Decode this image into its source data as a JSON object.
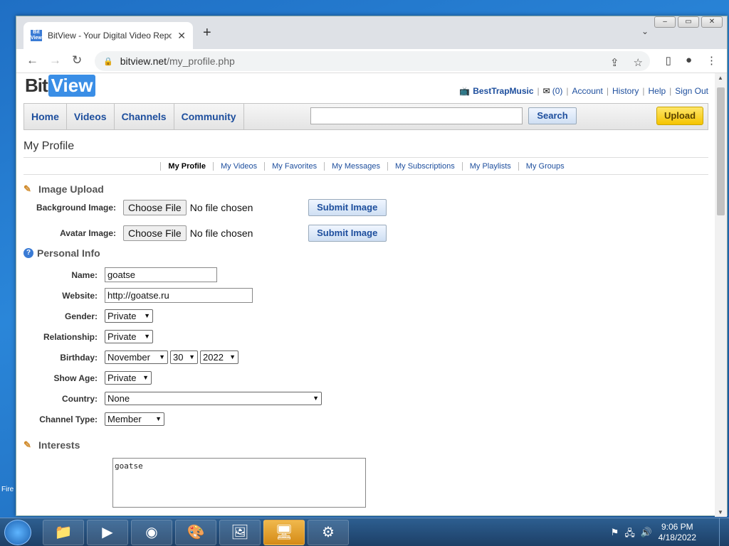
{
  "desktop": {
    "edge_label": "Fire"
  },
  "browser": {
    "tab_title": "BitView - Your Digital Video Repository",
    "favicon_text": "Bit View",
    "url_host": "bitview.net",
    "url_path": "/my_profile.php"
  },
  "site": {
    "logo_bit": "Bit",
    "logo_view": "View",
    "userbar": {
      "username": "BestTrapMusic",
      "messages": "(0)",
      "links": [
        "Account",
        "History",
        "Help",
        "Sign Out"
      ]
    },
    "nav": [
      "Home",
      "Videos",
      "Channels",
      "Community"
    ],
    "search_button": "Search",
    "upload_button": "Upload"
  },
  "page": {
    "title": "My Profile",
    "subnav": [
      "My Profile",
      "My Videos",
      "My Favorites",
      "My Messages",
      "My Subscriptions",
      "My Playlists",
      "My Groups"
    ],
    "image_upload": {
      "heading": "Image Upload",
      "background_label": "Background Image:",
      "avatar_label": "Avatar Image:",
      "choose_file": "Choose File",
      "no_file": "No file chosen",
      "submit": "Submit Image"
    },
    "personal_info": {
      "heading": "Personal Info",
      "name_label": "Name:",
      "name_value": "goatse",
      "website_label": "Website:",
      "website_value": "http://goatse.ru",
      "gender_label": "Gender:",
      "gender_value": "Private",
      "relationship_label": "Relationship:",
      "relationship_value": "Private",
      "birthday_label": "Birthday:",
      "birthday_month": "November",
      "birthday_day": "30",
      "birthday_year": "2022",
      "show_age_label": "Show Age:",
      "show_age_value": "Private",
      "country_label": "Country:",
      "country_value": "None",
      "channel_type_label": "Channel Type:",
      "channel_type_value": "Member"
    },
    "interests": {
      "heading": "Interests",
      "value": "goatse"
    }
  },
  "taskbar": {
    "time": "9:06 PM",
    "date": "4/18/2022"
  }
}
